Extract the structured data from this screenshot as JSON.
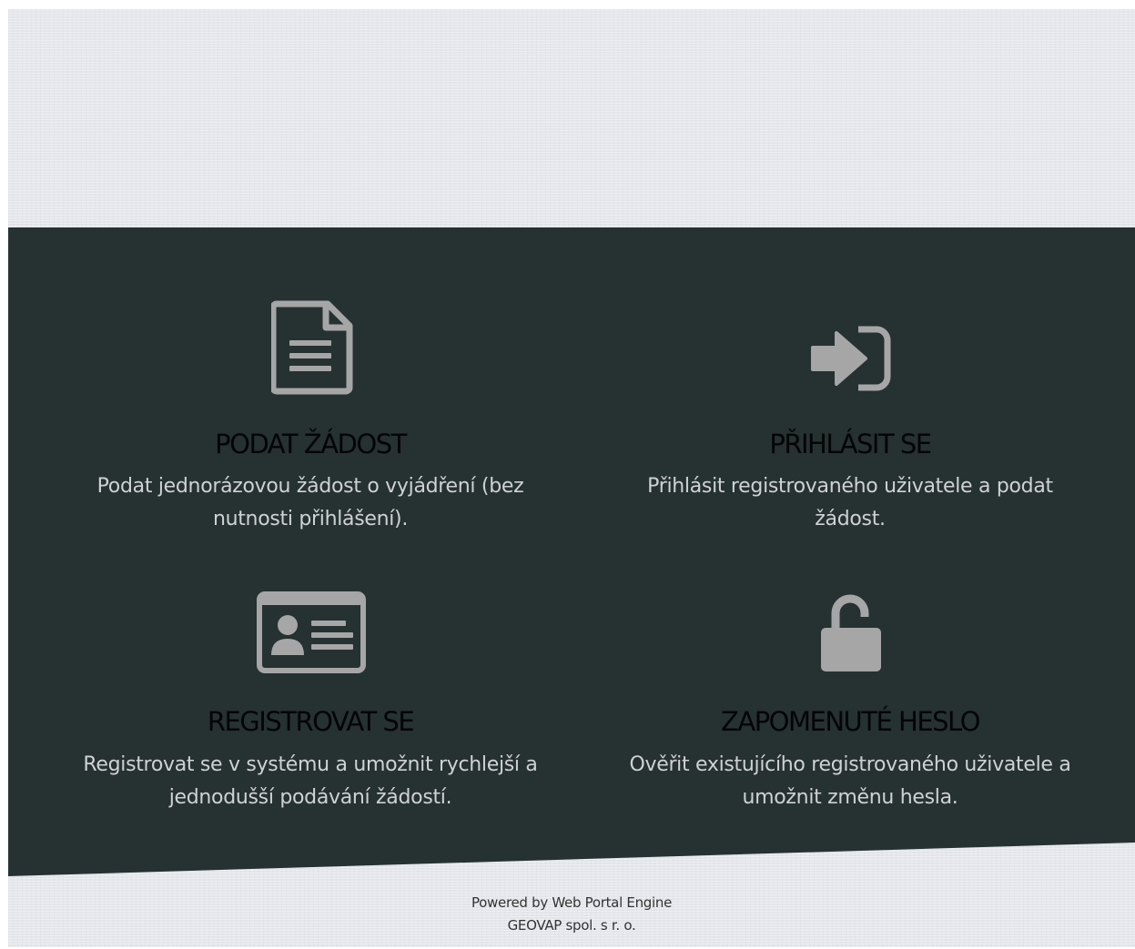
{
  "colors": {
    "background": "#e4e6eb",
    "band": "#263132",
    "icon": "#a6a6a6",
    "title": "#050505",
    "description": "#cfd2d2"
  },
  "cards": [
    {
      "icon": "document-icon",
      "title": "PODAT ŽÁDOST",
      "desc_line1": "Podat jednorázovou žádost o vyjádření (bez",
      "desc_line2": "nutnosti přihlášení)."
    },
    {
      "icon": "sign-in-icon",
      "title": "PŘIHLÁSIT SE",
      "desc_line1": "Přihlásit registrovaného uživatele a podat",
      "desc_line2": "žádost."
    },
    {
      "icon": "id-card-icon",
      "title": "REGISTROVAT SE",
      "desc_line1": "Registrovat se v systému a umožnit rychlejší a",
      "desc_line2": "jednodušší podávání žádostí."
    },
    {
      "icon": "unlock-icon",
      "title": "ZAPOMENUTÉ HESLO",
      "desc_line1": "Ověřit existujícího registrovaného uživatele a",
      "desc_line2": "umožnit změnu hesla."
    }
  ],
  "footer": {
    "line1": "Powered by Web Portal Engine",
    "line2": "GEOVAP spol. s r. o."
  }
}
